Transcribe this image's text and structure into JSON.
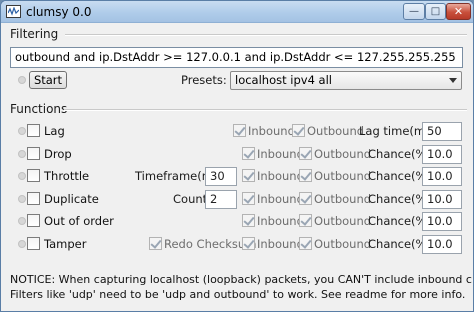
{
  "window": {
    "title": "clumsy 0.0"
  },
  "filtering": {
    "section_label": "Filtering",
    "filter_text": "outbound and ip.DstAddr >= 127.0.0.1 and ip.DstAddr <= 127.255.255.255",
    "start_label": "Start",
    "presets_label": "Presets:",
    "preset_selected": "localhost ipv4 all"
  },
  "functions": {
    "section_label": "Functions",
    "inbound_label": "Inbound",
    "outbound_label": "Outbound",
    "lag": {
      "label": "Lag",
      "param_label": "Lag time(ms):",
      "param_value": "50"
    },
    "drop": {
      "label": "Drop",
      "param_label": "Chance(%):",
      "param_value": "10.0"
    },
    "throttle": {
      "label": "Throttle",
      "timeframe_label": "Timeframe(ms):",
      "timeframe_value": "30",
      "param_label": "Chance(%):",
      "param_value": "10.0"
    },
    "duplicate": {
      "label": "Duplicate",
      "count_label": "Count:",
      "count_value": "2",
      "param_label": "Chance(%):",
      "param_value": "10.0"
    },
    "out_of_order": {
      "label": "Out of order",
      "param_label": "Chance(%):",
      "param_value": "10.0"
    },
    "tamper": {
      "label": "Tamper",
      "redo_label": "Redo Checksum",
      "param_label": "Chance(%):",
      "param_value": "10.0"
    }
  },
  "notice": {
    "line1": "NOTICE: When capturing localhost (loopback) packets, you CAN'T include inbound criteria.",
    "line2": "Filters like 'udp' need to be 'udp and outbound' to work. See readme for more info."
  }
}
